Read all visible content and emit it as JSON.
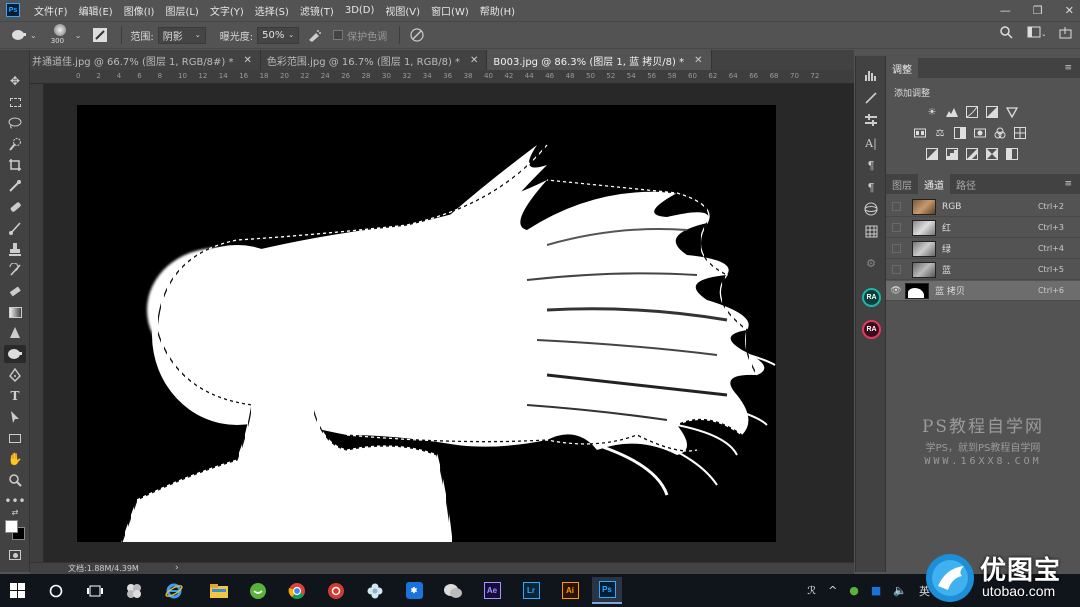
{
  "app": {
    "logo": "Ps"
  },
  "menu": [
    "文件(F)",
    "编辑(E)",
    "图像(I)",
    "图层(L)",
    "文字(Y)",
    "选择(S)",
    "滤镜(T)",
    "3D(D)",
    "视图(V)",
    "窗口(W)",
    "帮助(H)"
  ],
  "options": {
    "brush_size": "300",
    "range_label": "范围:",
    "range_value": "阴影",
    "exposure_label": "曝光度:",
    "exposure_value": "50%",
    "protect_tones": "保护色调"
  },
  "tabs": [
    {
      "label": "并通道佳.jpg @ 66.7% (图层 1, RGB/8#) *",
      "active": false
    },
    {
      "label": "色彩范围.jpg @ 16.7% (图层 1, RGB/8) *",
      "active": false
    },
    {
      "label": "B003.jpg @ 86.3% (图层 1, 蓝 拷贝/8) *",
      "active": true
    }
  ],
  "ruler_top": [
    "0",
    "2",
    "4",
    "6",
    "8",
    "10",
    "12",
    "14",
    "16",
    "18",
    "20",
    "22",
    "24",
    "26",
    "28",
    "30",
    "32",
    "34",
    "36",
    "38",
    "40",
    "42",
    "44",
    "46",
    "48",
    "50",
    "52",
    "54",
    "56",
    "58",
    "60",
    "62",
    "64",
    "66",
    "68",
    "70",
    "72"
  ],
  "status": {
    "doc": "文档:1.88M/4.39M"
  },
  "adjust_panel": {
    "title": "调整",
    "add": "添加调整"
  },
  "channels_panel": {
    "tabs": [
      "图层",
      "通道",
      "路径"
    ],
    "active_tab": "通道",
    "rows": [
      {
        "name": "RGB",
        "shortcut": "Ctrl+2",
        "visible": false,
        "selected": false
      },
      {
        "name": "红",
        "shortcut": "Ctrl+3",
        "visible": false,
        "selected": false
      },
      {
        "name": "绿",
        "shortcut": "Ctrl+4",
        "visible": false,
        "selected": false
      },
      {
        "name": "蓝",
        "shortcut": "Ctrl+5",
        "visible": false,
        "selected": false
      },
      {
        "name": "蓝 拷贝",
        "shortcut": "Ctrl+6",
        "visible": true,
        "selected": true
      }
    ]
  },
  "strip": {
    "ra1": "RA",
    "ra2": "RA"
  },
  "watermark": {
    "title": "PS教程自学网",
    "subtitle": "学PS，就到PS教程自学网",
    "url": "WWW.16XX8.COM"
  },
  "taskbar": {
    "ime": "英",
    "ae": "Ae",
    "lr": "Lr",
    "ai": "Ai",
    "ps": "Ps"
  },
  "brand": {
    "name": "优图宝",
    "url": "utobao.com"
  },
  "colors": {
    "ps_blue": "#31a8ff",
    "ae": "#9999ff",
    "lr": "#31a8ff",
    "ai": "#ff9a00"
  }
}
